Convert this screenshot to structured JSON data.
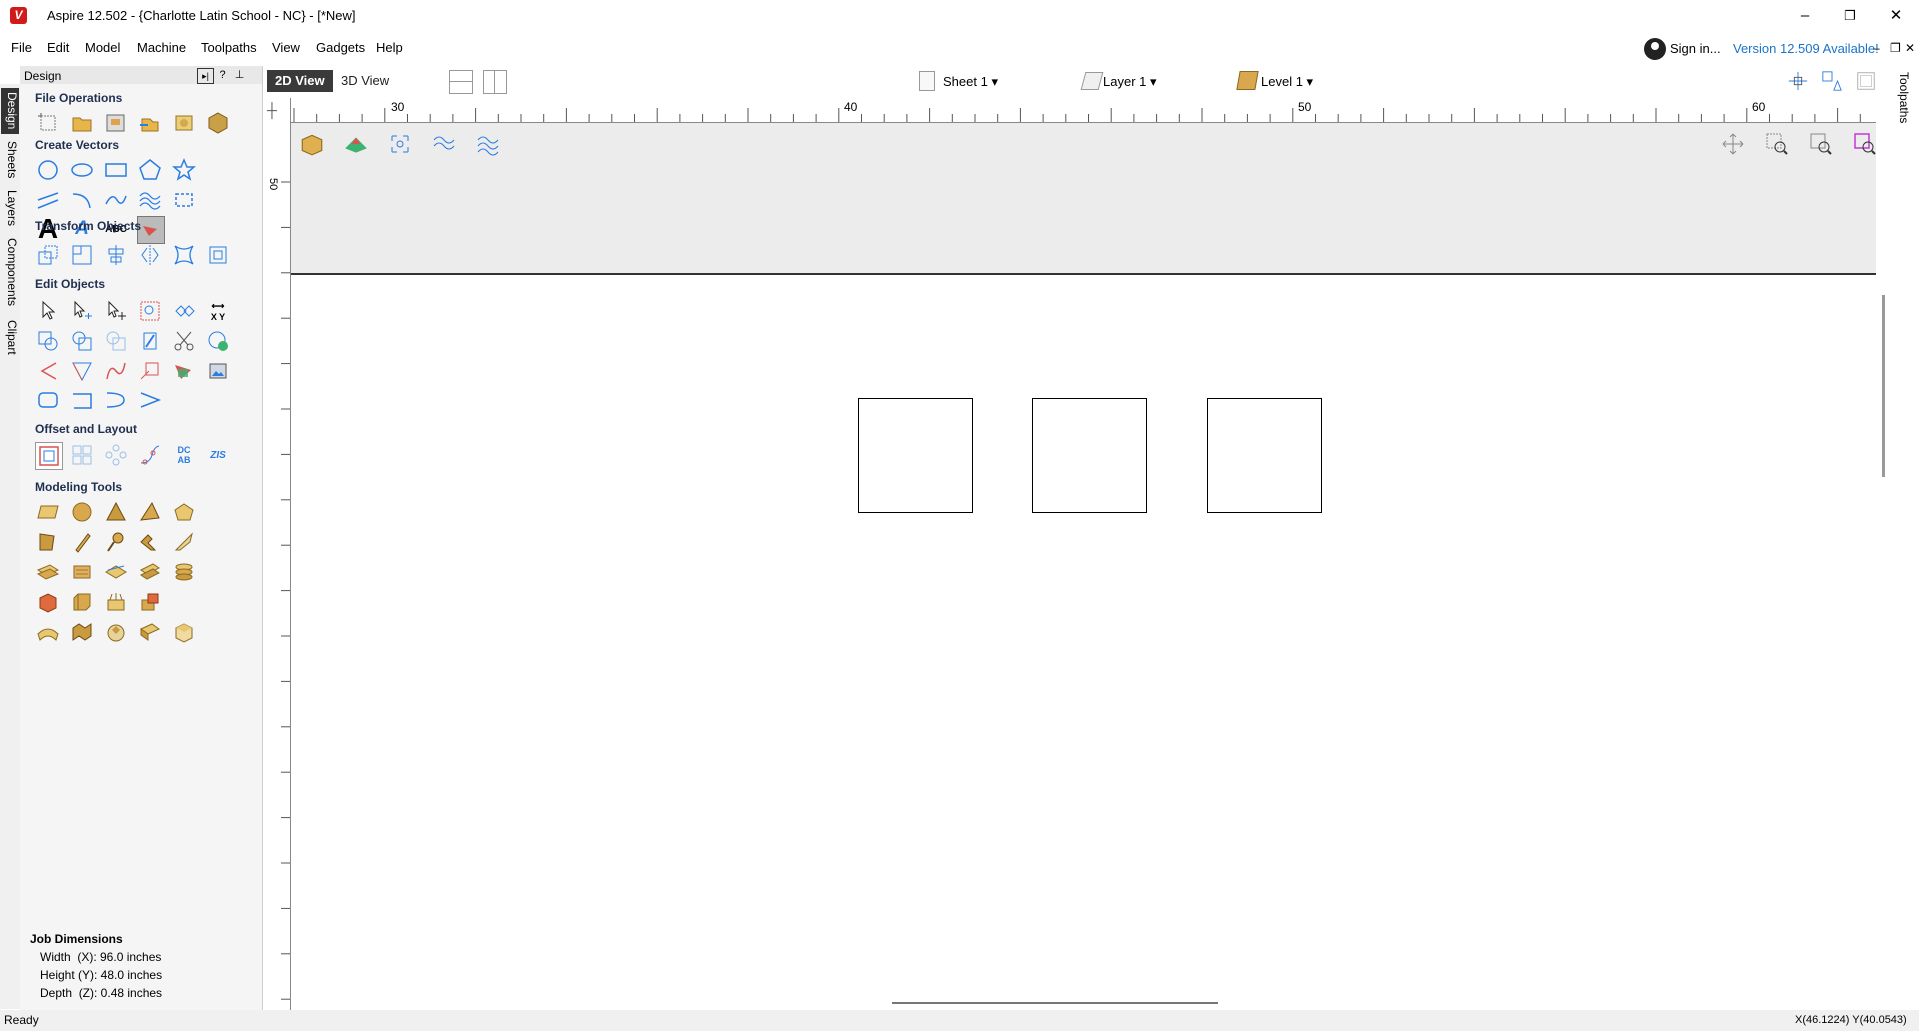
{
  "window": {
    "title": "Aspire 12.502 - {Charlotte Latin School - NC} - [*New]",
    "logo_letter": "V"
  },
  "window_controls": {
    "minimize": "–",
    "restore": "❐",
    "close": "✕"
  },
  "menu": {
    "items": [
      "File",
      "Edit",
      "Model",
      "Machine",
      "Toolpaths",
      "View",
      "Gadgets",
      "Help"
    ]
  },
  "account": {
    "sign_in": "Sign in...",
    "version_notice": "Version 12.509 Available!"
  },
  "mdi_controls": {
    "minimize": "–",
    "restore": "❐",
    "close": "✕"
  },
  "left_tabs": [
    "Design",
    "Sheets",
    "Layers",
    "Components",
    "Clipart"
  ],
  "panel": {
    "title": "Design",
    "help": "?",
    "sections": {
      "file_operations": "File Operations",
      "create_vectors": "Create Vectors",
      "transform_objects": "Transform Objects",
      "edit_objects": "Edit Objects",
      "offset_layout": "Offset and Layout",
      "modeling_tools": "Modeling Tools"
    },
    "text_tool_letter": "A",
    "text_tool_letter_small": "A",
    "arc_text_label": "ABC",
    "xy_label": "X Y",
    "layout_text_a": "DC",
    "layout_text_b": "AB",
    "layout_text_c": "ZIS",
    "job": {
      "title": "Job Dimensions",
      "width": "Width  (X): 96.0 inches",
      "height": "Height (Y): 48.0 inches",
      "depth": "Depth  (Z): 0.48 inches"
    }
  },
  "view": {
    "tab_2d": "2D View",
    "tab_3d": "3D View",
    "sheet": "Sheet 1",
    "layer": "Layer 1",
    "level": "Level 1"
  },
  "ruler": {
    "h_labels": [
      "30",
      "40",
      "50",
      "60"
    ],
    "v_label": "50"
  },
  "right_tab": "Toolpaths",
  "status": {
    "text": "Ready",
    "coords": "X(46.1224) Y(40.0543)"
  },
  "colors": {
    "accent": "#1a73c9",
    "icon_blue": "#2a7de1",
    "model_tan": "#d9a84e"
  }
}
